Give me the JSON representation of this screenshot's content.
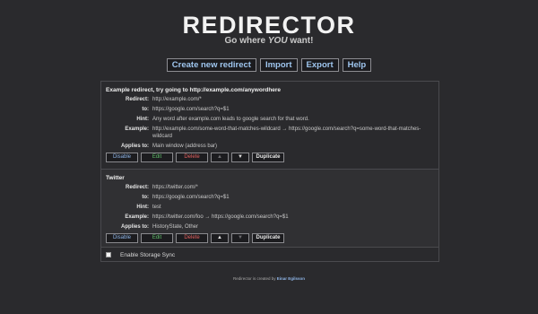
{
  "header": {
    "logo": "REDIRECTOR",
    "tagline_pre": "Go where ",
    "tagline_em": "YOU",
    "tagline_post": " want!"
  },
  "toolbar": {
    "create": "Create new redirect",
    "import": "Import",
    "export": "Export",
    "help": "Help"
  },
  "labels": {
    "redirect": "Redirect:",
    "to": "to:",
    "hint": "Hint:",
    "example": "Example:",
    "applies_to": "Applies to:"
  },
  "buttons": {
    "disable": "Disable",
    "edit": "Edit",
    "delete": "Delete",
    "up": "▲",
    "down": "▼",
    "duplicate": "Duplicate"
  },
  "redirects": [
    {
      "title": "Example redirect, try going to http://example.com/anywordhere",
      "redirect": "http://example.com/*",
      "to": "https://google.com/search?q=$1",
      "hint": "Any word after example.com leads to google search for that word.",
      "example": "http://example.com/some-word-that-matches-wildcard → https://google.com/search?q=some-word-that-matches-wildcard",
      "applies_to": "Main window (address bar)"
    },
    {
      "title": "Twitter",
      "redirect": "https://twitter.com/*",
      "to": "https://google.com/search?q=$1",
      "hint": "test",
      "example": "https://twitter.com/foo → https://google.com/search?q=$1",
      "applies_to": "HistoryState, Other"
    }
  ],
  "storage_sync": {
    "label": "Enable Storage Sync",
    "checked": false
  },
  "footer": {
    "text": "Redirector is created by ",
    "author": "Einar Egilsson"
  }
}
